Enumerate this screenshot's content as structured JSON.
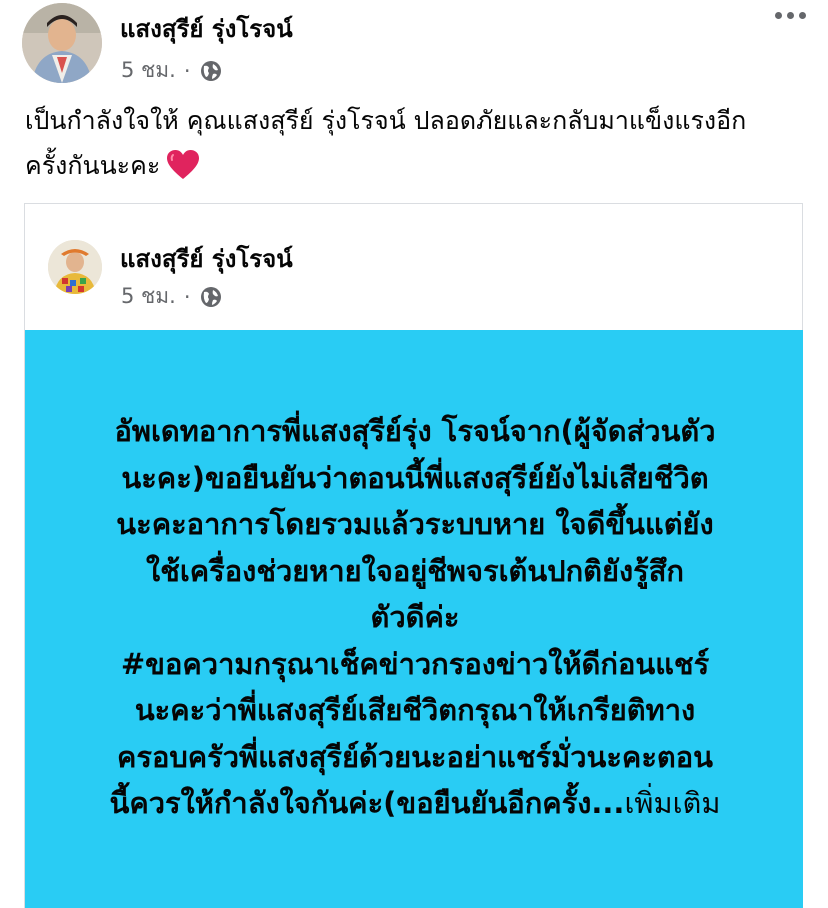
{
  "post": {
    "author": "แสงสุรีย์ รุ่งโรจน์",
    "time": "5 ชม.",
    "separator": "·",
    "audience_icon": "globe-icon",
    "menu_icon": "more-options-icon",
    "text_lines": [
      "เป็นกำลังใจให้ คุณแสงสุรีย์ รุ่งโรจน์ ปลอดภัยและกลับมาแข็งแรงอีก",
      "ครั้งกันนะคะ"
    ],
    "emoji_icon": "red-heart-icon"
  },
  "shared": {
    "author": "แสงสุรีย์ รุ่งโรจน์",
    "time": "5 ชม.",
    "separator": "·",
    "audience_icon": "globe-icon",
    "background_color": "#29ccf4",
    "lines": [
      "อัพเดทอาการพี่แสงสุรีย์รุ่ง โรจน์จาก(ผู้จัดส่วนตัว",
      "นะคะ)ขอยืนยันว่าตอนนี้พี่แสงสุรีย์ยังไม่เสียชีวิต",
      "นะคะอาการโดยรวมแล้วระบบหาย ใจดีขึ้นแต่ยัง",
      "ใช้เครื่องช่วยหายใจอยู่ชีพจรเต้นปกติยังรู้สึก",
      "ตัวดีค่ะ",
      "#ขอความกรุณาเช็คข่าวกรองข่าวให้ดีก่อนแชร์",
      "นะคะว่าพี่แสงสุรีย์เสียชีวิตกรุณาให้เกรียติทาง",
      "ครอบครัวพี่แสงสุรีย์ด้วยนะอย่าแชร์มั่วนะคะตอน",
      "นี้ควรให้กำลังใจกันค่ะ(ขอยืนยันอีกครั้ง..."
    ],
    "see_more": "เพิ่มเติม"
  }
}
